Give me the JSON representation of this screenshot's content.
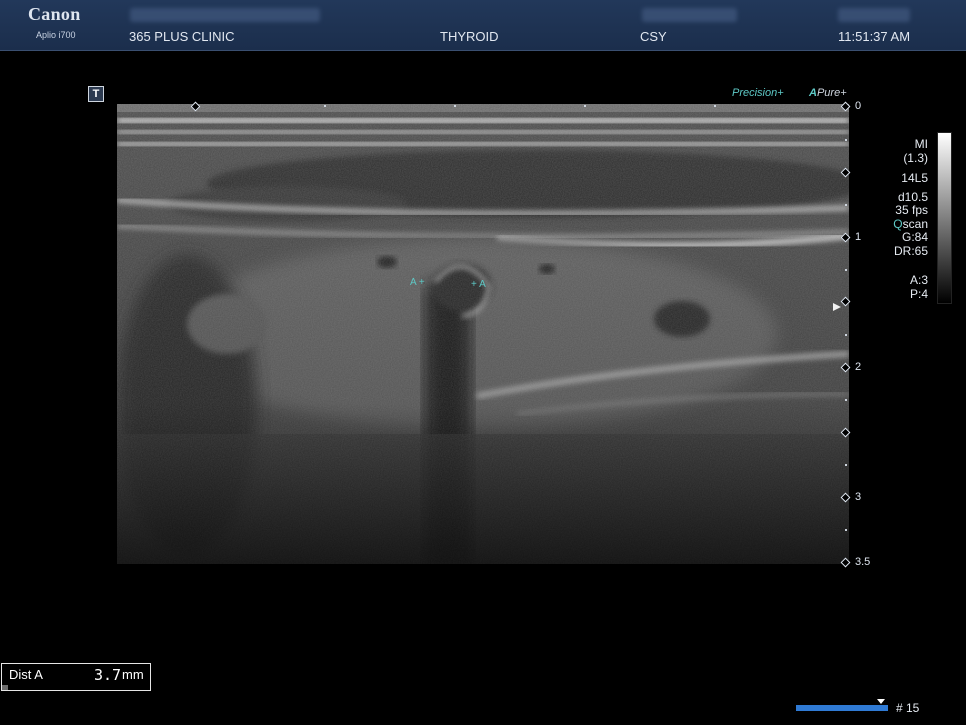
{
  "header": {
    "brand": "Canon",
    "model": "Aplio i700",
    "clinic": "365 PLUS CLINIC",
    "exam": "THYROID",
    "operator": "CSY",
    "time": "11:51:37 AM"
  },
  "image_labels": {
    "precision": "Precision+",
    "apure_a": "A",
    "apure_rest": "Pure+",
    "t_icon": "T"
  },
  "depth_scale": {
    "labels": [
      "0",
      "1",
      "2",
      "3",
      "3.5"
    ]
  },
  "info_panel": {
    "mi": "MI",
    "mi_value": "(1.3)",
    "probe": "14L5",
    "depth": "d10.5",
    "fps": "35 fps",
    "qscan_q": "Q",
    "qscan_rest": "scan",
    "gain": "G:84",
    "dr": "DR:65",
    "a": "A:3",
    "p": "P:4"
  },
  "calipers": {
    "left": "A +",
    "right": "+ A"
  },
  "measurement": {
    "label": "Dist A",
    "value": "3.7",
    "unit": "mm"
  },
  "cine": {
    "frame": "# 15"
  },
  "colors": {
    "header_bg": "#1b2e4c",
    "accent_teal": "#5ec9c6",
    "cine_blue": "#2f7ad4"
  }
}
